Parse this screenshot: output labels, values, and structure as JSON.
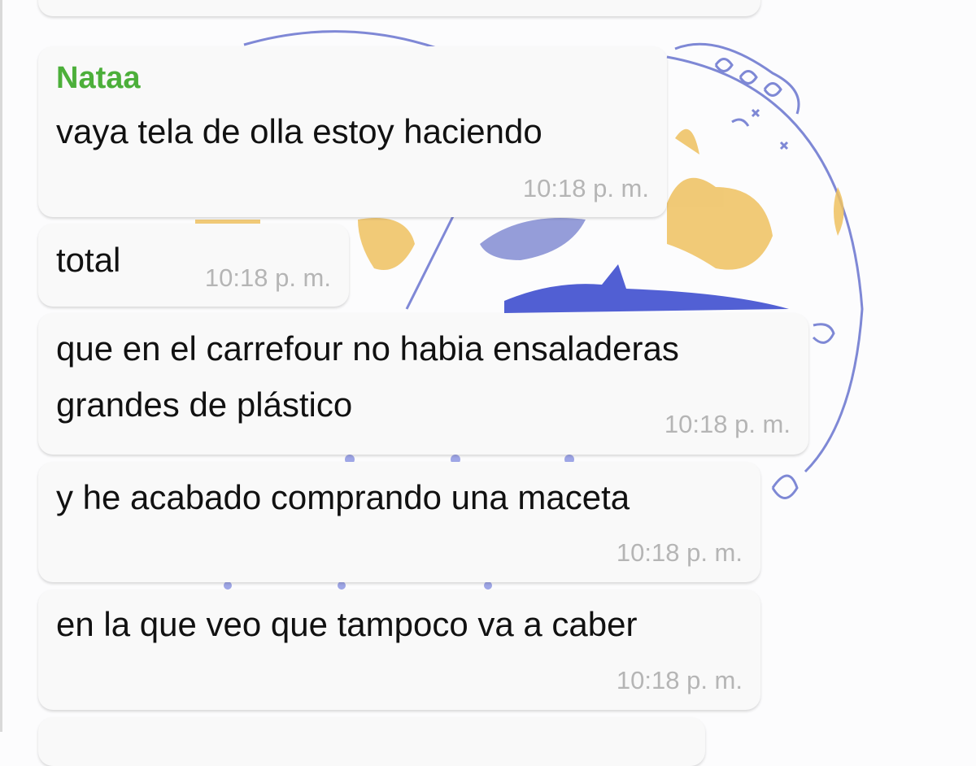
{
  "chat": {
    "colors": {
      "sender_name": "#4caf3a",
      "bubble": "#f9f9f9",
      "timestamp": "#b5b5b5",
      "text": "#111111"
    },
    "messages": [
      {
        "sender": "Nataa",
        "lines": [
          "vaya tela de olla estoy haciendo"
        ],
        "time": "10:18 p. m."
      },
      {
        "lines": [
          "total"
        ],
        "time": "10:18 p. m."
      },
      {
        "lines": [
          "que en el carrefour no habia ensaladeras",
          "grandes de plástico"
        ],
        "time": "10:18 p. m."
      },
      {
        "lines": [
          "y he acabado comprando una maceta"
        ],
        "time": "10:18 p. m."
      },
      {
        "lines": [
          "en la que veo que tampoco va a caber"
        ],
        "time": "10:18 p. m."
      }
    ]
  }
}
